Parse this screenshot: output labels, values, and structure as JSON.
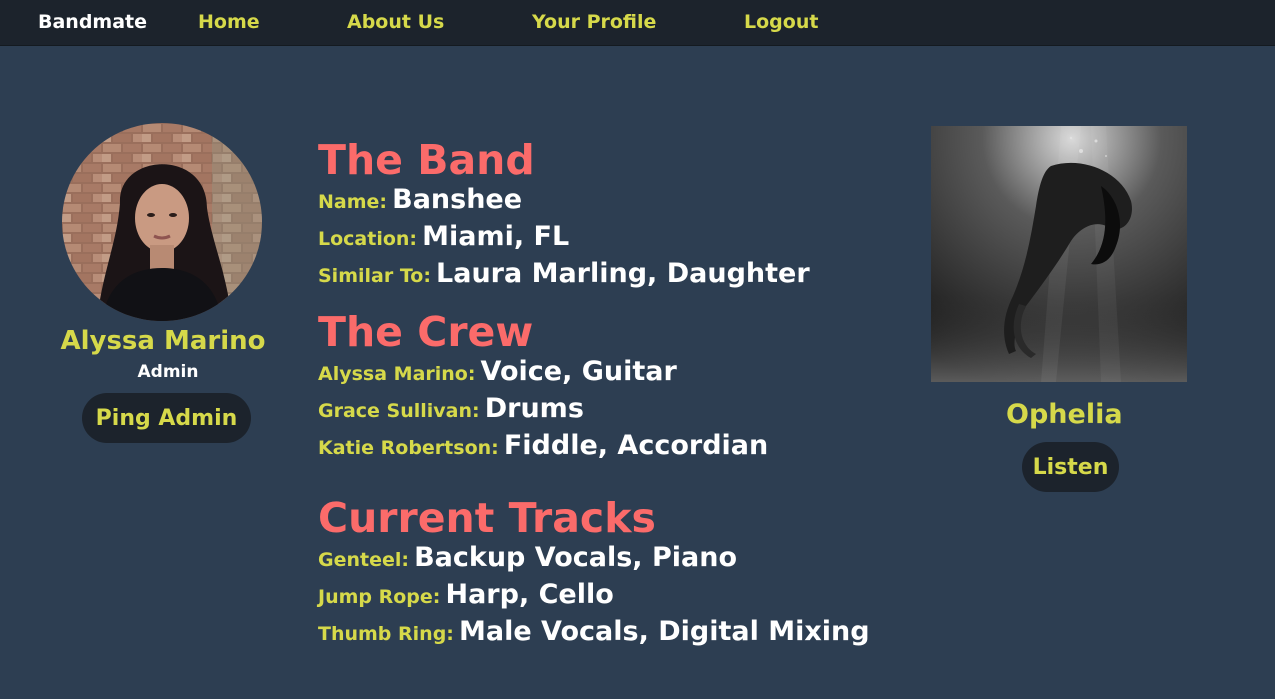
{
  "nav": {
    "brand": "Bandmate",
    "links": [
      "Home",
      "About Us",
      "Your Profile",
      "Logout"
    ]
  },
  "admin": {
    "name": "Alyssa Marino",
    "role": "Admin",
    "ping_label": "Ping Admin"
  },
  "band": {
    "title": "The Band",
    "rows": [
      {
        "label": "Name:",
        "value": "Banshee"
      },
      {
        "label": "Location:",
        "value": "Miami, FL"
      },
      {
        "label": "Similar To:",
        "value": "Laura Marling, Daughter"
      }
    ]
  },
  "crew": {
    "title": "The Crew",
    "rows": [
      {
        "label": "Alyssa Marino:",
        "value": "Voice, Guitar"
      },
      {
        "label": "Grace Sullivan:",
        "value": "Drums"
      },
      {
        "label": "Katie Robertson:",
        "value": "Fiddle, Accordian"
      }
    ]
  },
  "tracks": {
    "title": "Current Tracks",
    "rows": [
      {
        "label": "Genteel:",
        "value": "Backup Vocals, Piano"
      },
      {
        "label": "Jump Rope:",
        "value": "Harp, Cello"
      },
      {
        "label": "Thumb Ring:",
        "value": "Male Vocals, Digital Mixing"
      }
    ]
  },
  "featured": {
    "name": "Ophelia",
    "listen_label": "Listen"
  },
  "colors": {
    "background": "#2d3e52",
    "navbar": "#1c232c",
    "accent_yellow": "#d6d94a",
    "heading_coral": "#fb6b6a",
    "text_white": "#ffffff"
  }
}
